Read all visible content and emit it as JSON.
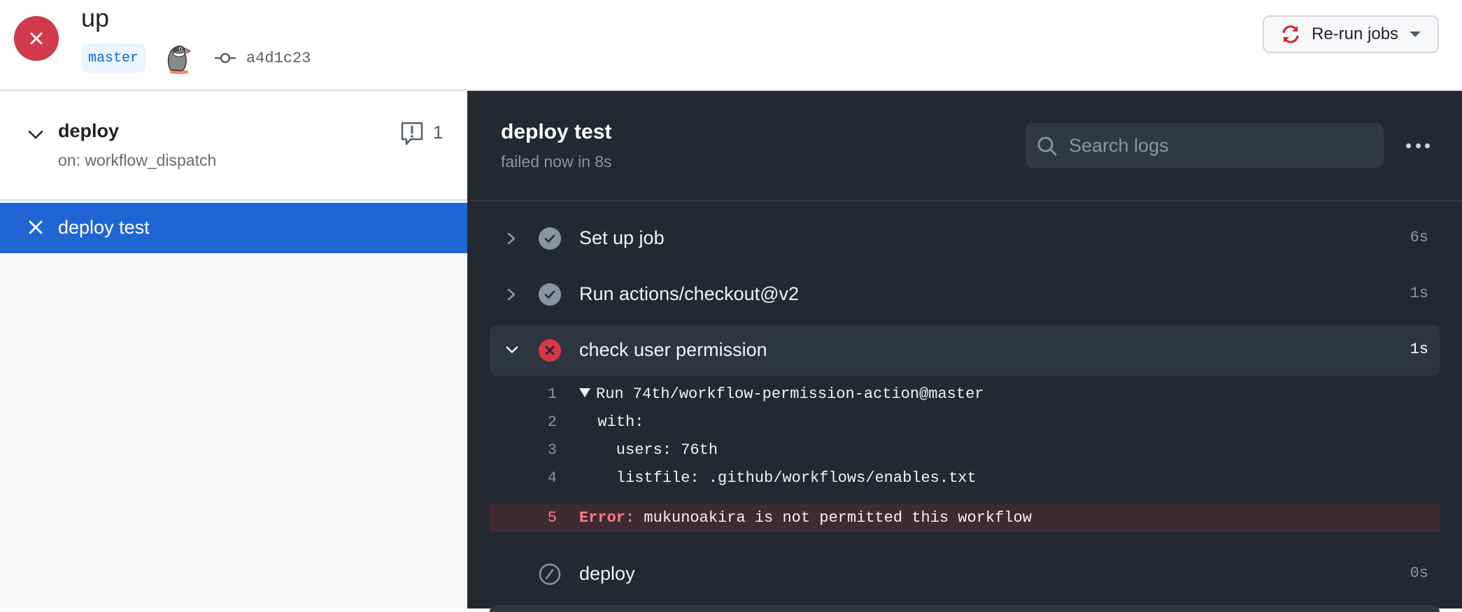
{
  "header": {
    "run_title": "up",
    "branch": "master",
    "commit_sha": "a4d1c23",
    "rerun_label": "Re-run jobs",
    "status": "failure",
    "status_color": "#cf3a4c"
  },
  "sidebar": {
    "workflow_name": "deploy",
    "workflow_trigger": "on: workflow_dispatch",
    "annotation_count": "1",
    "jobs": [
      {
        "label": "deploy test",
        "status": "failed",
        "selected": true
      }
    ],
    "accent_color": "#1f66d4"
  },
  "log": {
    "job_title": "deploy test",
    "job_subtitle": "failed now in 8s",
    "search_placeholder": "Search logs",
    "steps": [
      {
        "name": "Set up job",
        "duration": "6s",
        "status": "success",
        "expanded": false
      },
      {
        "name": "Run actions/checkout@v2",
        "duration": "1s",
        "status": "success",
        "expanded": false
      },
      {
        "name": "check user permission",
        "duration": "1s",
        "status": "failure",
        "expanded": true
      },
      {
        "name": "deploy",
        "duration": "0s",
        "status": "skipped",
        "expanded": false
      }
    ],
    "lines": [
      {
        "num": "1",
        "text": "Run 74th/workflow-permission-action@master",
        "group": true
      },
      {
        "num": "2",
        "text": "  with:"
      },
      {
        "num": "3",
        "text": "    users: 76th"
      },
      {
        "num": "4",
        "text": "    listfile: .github/workflows/enables.txt"
      },
      {
        "num": "5",
        "keyword": "Error:",
        "text": " mukunoakira is not permitted this workflow",
        "error": true
      }
    ]
  }
}
